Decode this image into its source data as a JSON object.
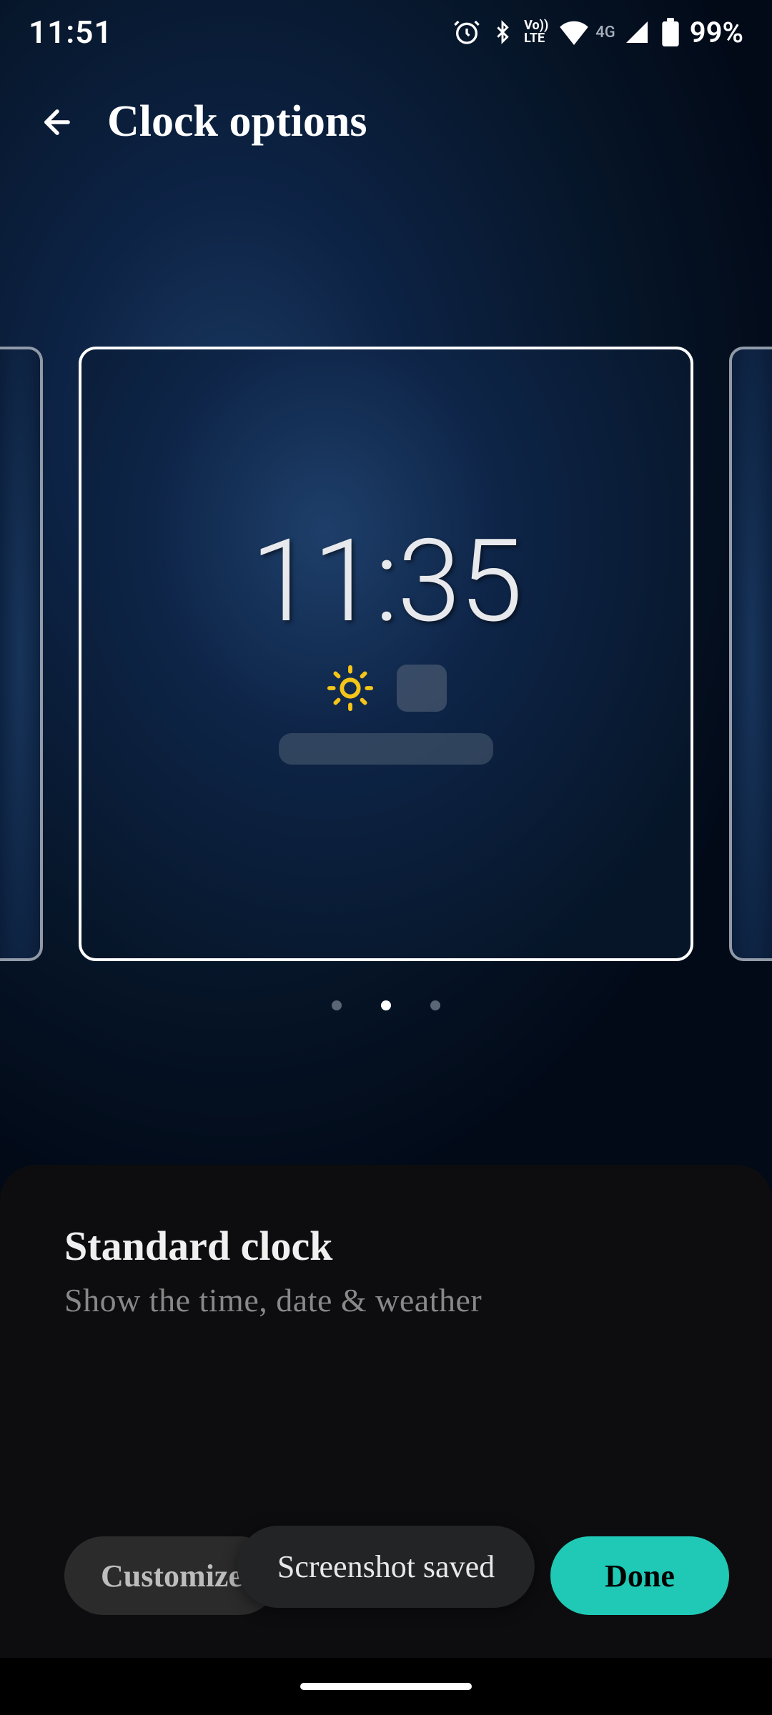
{
  "status": {
    "time": "11:51",
    "volte_top": "Vo))",
    "volte_bottom": "LTE",
    "network": "4G",
    "battery": "99%"
  },
  "header": {
    "title": "Clock options"
  },
  "preview": {
    "time": "11:35"
  },
  "pager": {
    "count": 3,
    "active_index": 1
  },
  "sheet": {
    "title": "Standard clock",
    "subtitle": "Show the time, date & weather"
  },
  "buttons": {
    "customize": "Customize",
    "done": "Done"
  },
  "toast": {
    "message": "Screenshot saved"
  }
}
